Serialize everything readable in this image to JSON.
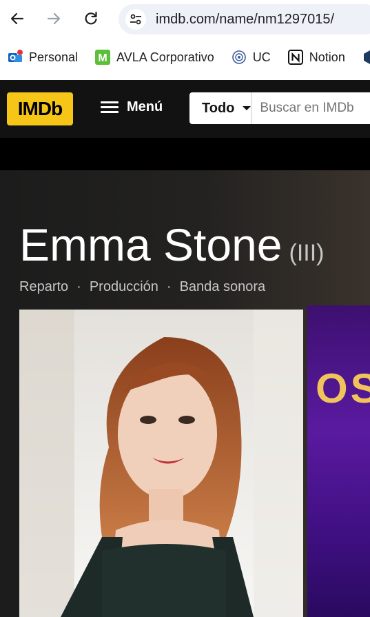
{
  "browser": {
    "url": "imdb.com/name/nm1297015/",
    "bookmarks": [
      {
        "label": "Personal",
        "icon": "outlook-icon"
      },
      {
        "label": "AVLA Corporativo",
        "icon": "avla-m-icon"
      },
      {
        "label": "UC",
        "icon": "uc-seal-icon"
      },
      {
        "label": "Notion",
        "icon": "notion-icon"
      }
    ]
  },
  "imdb": {
    "logo_text": "IMDb",
    "menu_label": "Menú",
    "search": {
      "category": "Todo",
      "placeholder": "Buscar en IMDb"
    }
  },
  "person": {
    "name": "Emma Stone",
    "suffix": "(III)",
    "roles": [
      "Reparto",
      "Producción",
      "Banda sonora"
    ]
  },
  "poster": {
    "visible_text": "OS"
  },
  "colors": {
    "imdb_yellow": "#f5c518",
    "header_bg": "#121212",
    "hero_text": "#ffffff",
    "subtle_text": "#c6c6c6",
    "poster_purple": "#5a1aa0"
  }
}
